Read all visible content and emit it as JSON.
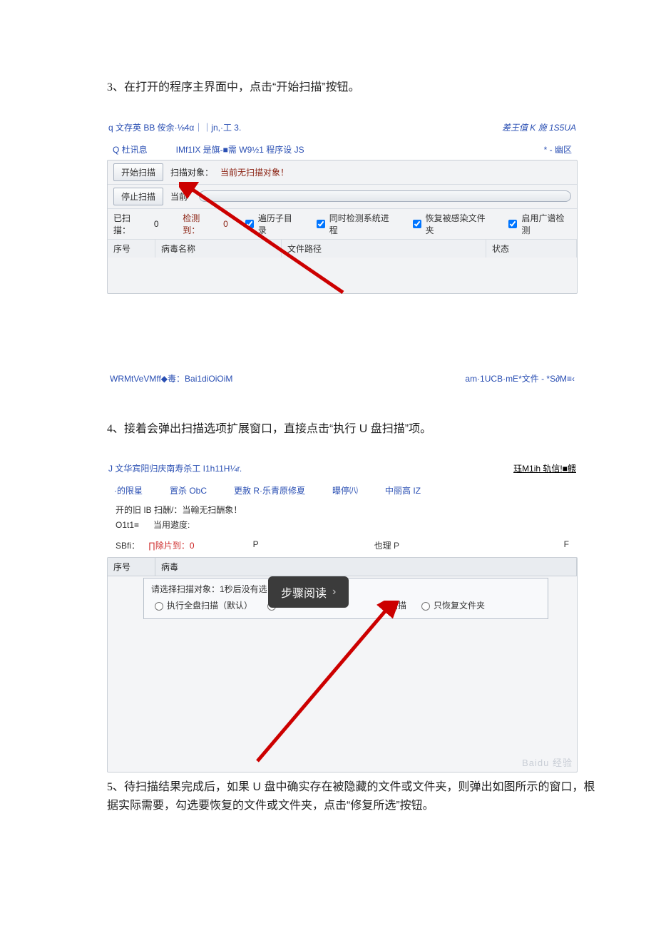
{
  "step3": {
    "num": "3",
    "sep": "、",
    "text": "在打开的程序主界面中，点击“开始扫描”按钮。"
  },
  "shot1": {
    "titlebar_left": "q 文存英 BB 侒余·⅛4α｜｜jn,·工 3.",
    "titlebar_right_prefix": "差王值 K 施 ",
    "titlebar_right_italic": "1S5UA",
    "tabs": [
      "Q 杜讯息",
      "IMf1IX 是旗-■需 W9½1 程序设 JS",
      "* - 幽区"
    ],
    "btn_start": "开始扫描",
    "row1_label": "扫描对象：",
    "row1_value": "当前无扫描对象！",
    "btn_stop": "停止扫描",
    "row2_label": "当前",
    "row3_scanned_label": "已扫描：",
    "row3_scanned_value": "0",
    "row3_detected_label": "检测到：",
    "row3_detected_value": "0",
    "checks": [
      "遍历子目录",
      "同时检测系统进程",
      "恢复被感染文件夹",
      "启用广谱检测"
    ],
    "columns": [
      "序号",
      "病毒名称",
      "文件路径",
      "状态"
    ],
    "footer_left": "WRMtVeVMff◆毒：Bai1diOiOiM",
    "footer_right": "am·1UCB·mE*文件 - *S∂M≡‹"
  },
  "step4": {
    "num": "4",
    "sep": "、",
    "text": "接着会弹出扫描选项扩展窗口，直接点击“执行 U 盘扫描”项。"
  },
  "shot2": {
    "titlebar_left": "J 文华宾阳归庆南寿杀工 I1h11H¼r.",
    "titlebar_right": "珏M1ih 轨信!■鳂",
    "tabs": [
      "·的限星",
      "置杀 ObC",
      "更赦 R·乐青原修夏",
      "曝停㈧",
      "中丽高 IZ"
    ],
    "info_line1": "开的旧 IB 扫酬/：当翰无扫酬象！",
    "info_line2_label": "O1t1≡",
    "info_line2_text": "当用遨度:",
    "stats_a": "SBfi：",
    "stats_b_label": "∏除片到：",
    "stats_b_value": "0",
    "stats_c": "P",
    "stats_d": "也理 P",
    "stats_e": "F",
    "col1": "序号",
    "col2": "病毒",
    "popup_msg": "请选择扫描对象：1秒后没有选…",
    "popup_opts": [
      "执行全盘扫描（默认）",
      "",
      "径扫描",
      "只恢复文件夹"
    ],
    "tooltip": "步骤阅读",
    "watermark": "Baidu 经验"
  },
  "step5": {
    "num": "5",
    "sep": "、",
    "text": "待扫描结果完成后，如果 U 盘中确实存在被隐藏的文件或文件夹，则弹出如图所示的窗口，根据实际需要，勾选要恢复的文件或文件夹，点击“修复所选”按钮。"
  }
}
